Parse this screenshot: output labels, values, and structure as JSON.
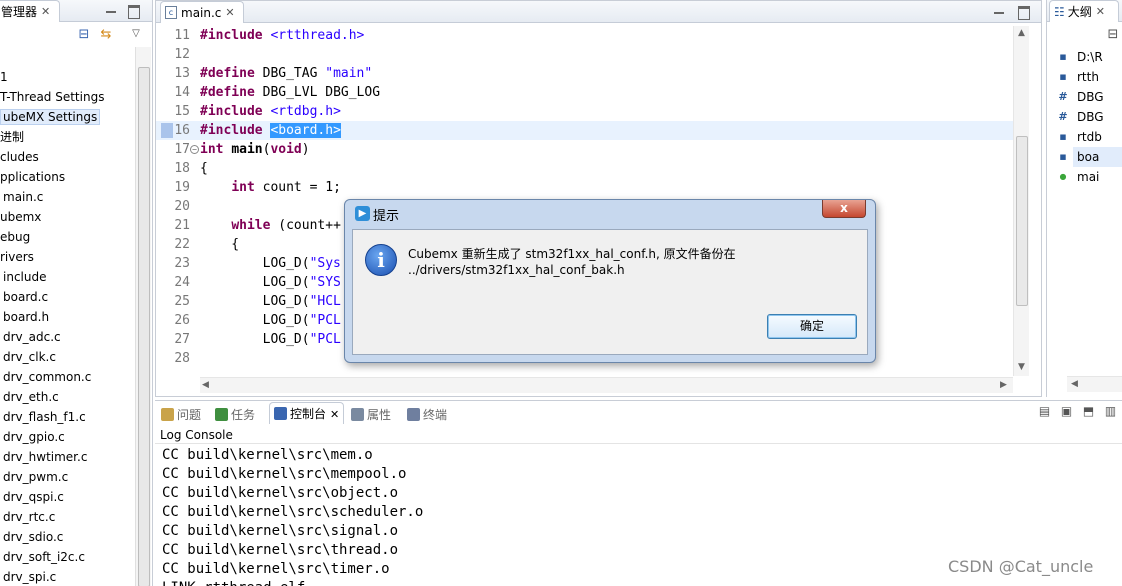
{
  "left_panel": {
    "tab_label": "管理器",
    "tree": [
      {
        "label": "1",
        "indent": 0
      },
      {
        "label": "T-Thread Settings",
        "indent": 0
      },
      {
        "label": "ubeMX Settings",
        "indent": 0,
        "selected": true
      },
      {
        "label": "进制",
        "indent": 0
      },
      {
        "label": "cludes",
        "indent": 0
      },
      {
        "label": "pplications",
        "indent": 0
      },
      {
        "label": "main.c",
        "indent": 3
      },
      {
        "label": "ubemx",
        "indent": 0
      },
      {
        "label": "ebug",
        "indent": 0
      },
      {
        "label": "rivers",
        "indent": 0
      },
      {
        "label": "include",
        "indent": 3
      },
      {
        "label": "board.c",
        "indent": 3
      },
      {
        "label": "board.h",
        "indent": 3
      },
      {
        "label": "drv_adc.c",
        "indent": 3
      },
      {
        "label": "drv_clk.c",
        "indent": 3
      },
      {
        "label": "drv_common.c",
        "indent": 3
      },
      {
        "label": "drv_eth.c",
        "indent": 3
      },
      {
        "label": "drv_flash_f1.c",
        "indent": 3
      },
      {
        "label": "drv_gpio.c",
        "indent": 3
      },
      {
        "label": "drv_hwtimer.c",
        "indent": 3
      },
      {
        "label": "drv_pwm.c",
        "indent": 3
      },
      {
        "label": "drv_qspi.c",
        "indent": 3
      },
      {
        "label": "drv_rtc.c",
        "indent": 3
      },
      {
        "label": "drv_sdio.c",
        "indent": 3
      },
      {
        "label": "drv_soft_i2c.c",
        "indent": 3
      },
      {
        "label": "drv_spi.c",
        "indent": 3
      }
    ]
  },
  "editor": {
    "tab_label": "main.c",
    "lines": [
      {
        "n": "11",
        "html": "<span class=\"kw\">#include</span> <span class=\"str\">&lt;rtthread.h&gt;</span>"
      },
      {
        "n": "12",
        "html": ""
      },
      {
        "n": "13",
        "html": "<span class=\"kw\">#define</span> DBG_TAG <span class=\"str\">\"main\"</span>"
      },
      {
        "n": "14",
        "html": "<span class=\"kw\">#define</span> DBG_LVL DBG_LOG"
      },
      {
        "n": "15",
        "html": "<span class=\"kw\">#include</span> <span class=\"str\">&lt;rtdbg.h&gt;</span>"
      },
      {
        "n": "16",
        "html": "<span class=\"kw\">#include</span> <span class=\"sel-text\">&lt;board.h&gt;</span>",
        "highlight": true,
        "marker": true
      },
      {
        "n": "17",
        "html": "<span class=\"kw\">int</span> <b>main</b>(<span class=\"kw\">void</span>)",
        "fold": true
      },
      {
        "n": "18",
        "html": "{"
      },
      {
        "n": "19",
        "html": "    <span class=\"kw\">int</span> count = 1;"
      },
      {
        "n": "20",
        "html": ""
      },
      {
        "n": "21",
        "html": "    <span class=\"kw\">while</span> (count++"
      },
      {
        "n": "22",
        "html": "    {"
      },
      {
        "n": "23",
        "html": "        LOG_D(<span class=\"str\">\"Sys</span>"
      },
      {
        "n": "24",
        "html": "        LOG_D(<span class=\"str\">\"SYS</span>"
      },
      {
        "n": "25",
        "html": "        LOG_D(<span class=\"str\">\"HCL</span>"
      },
      {
        "n": "26",
        "html": "        LOG_D(<span class=\"str\">\"PCL</span>"
      },
      {
        "n": "27",
        "html": "        LOG_D(<span class=\"str\">\"PCL</span>"
      },
      {
        "n": "28",
        "html": ""
      }
    ]
  },
  "outline": {
    "tab_label": "大纲",
    "items": [
      {
        "label": "D:\\R",
        "icon": "▪"
      },
      {
        "label": "rtth",
        "icon": "▪"
      },
      {
        "label": "DBG",
        "icon": "#"
      },
      {
        "label": "DBG",
        "icon": "#"
      },
      {
        "label": "rtdb",
        "icon": "▪"
      },
      {
        "label": "boa",
        "icon": "▪"
      },
      {
        "label": "mai",
        "icon": "●"
      }
    ]
  },
  "console": {
    "tabs": [
      {
        "label": "问题",
        "active": false
      },
      {
        "label": "任务",
        "active": false
      },
      {
        "label": "控制台",
        "active": true
      },
      {
        "label": "属性",
        "active": false
      },
      {
        "label": "终端",
        "active": false
      }
    ],
    "header": "Log Console",
    "lines": [
      "CC build\\kernel\\src\\mem.o",
      "CC build\\kernel\\src\\mempool.o",
      "CC build\\kernel\\src\\object.o",
      "CC build\\kernel\\src\\scheduler.o",
      "CC build\\kernel\\src\\signal.o",
      "CC build\\kernel\\src\\thread.o",
      "CC build\\kernel\\src\\timer.o",
      "LINK rtthread.elf"
    ]
  },
  "dialog": {
    "title": "提示",
    "message": "Cubemx 重新生成了 stm32f1xx_hal_conf.h, 原文件备份在 ../drivers/stm32f1xx_hal_conf_bak.h",
    "ok_label": "确定",
    "close_label": "x"
  },
  "watermark": "CSDN @Cat_uncle"
}
